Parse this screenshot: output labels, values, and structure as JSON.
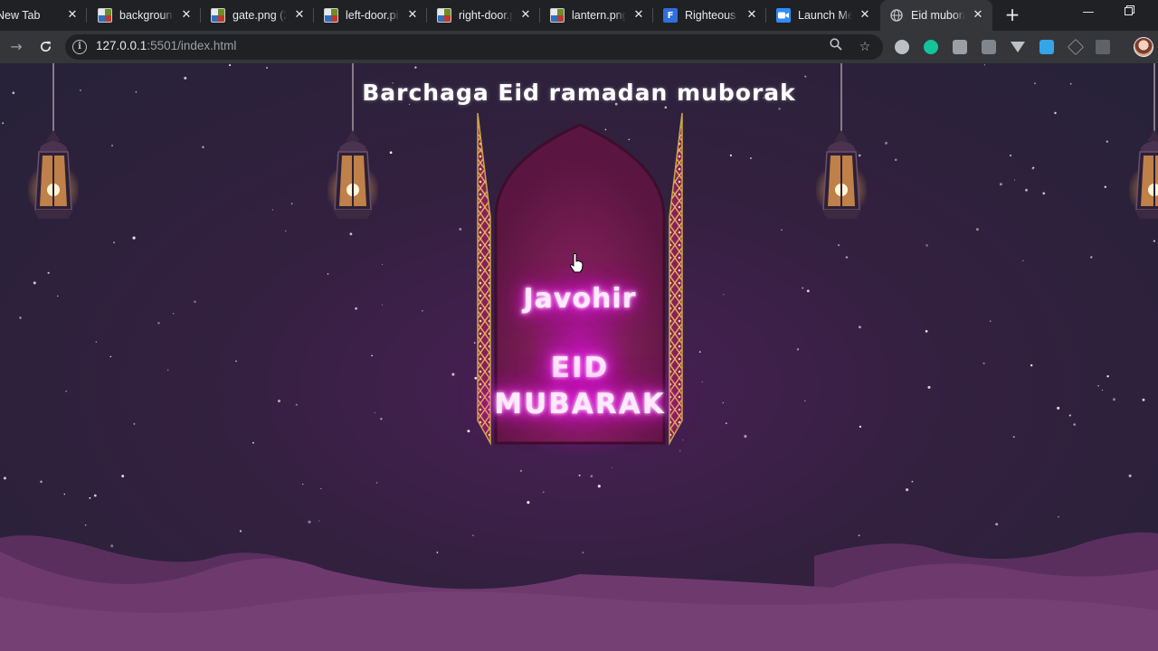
{
  "browser": {
    "tabs": [
      {
        "title": "New Tab",
        "favicon": "none"
      },
      {
        "title": "background",
        "favicon": "image-file-icon"
      },
      {
        "title": "gate.png (2",
        "favicon": "image-file-icon"
      },
      {
        "title": "left-door.pi",
        "favicon": "image-file-icon"
      },
      {
        "title": "right-door.p",
        "favicon": "image-file-icon"
      },
      {
        "title": "lantern.png",
        "favicon": "image-file-icon"
      },
      {
        "title": "Righteous -",
        "favicon": "font-f-icon"
      },
      {
        "title": "Launch Me",
        "favicon": "zoom-camera-icon"
      },
      {
        "title": "Eid muborak",
        "favicon": "globe-icon",
        "active": true
      }
    ],
    "new_tab_symbol": "+",
    "close_symbol": "✕",
    "url_host": "127.0.0.1",
    "url_rest": ":5501/index.html"
  },
  "page": {
    "title": "Barchaga Eid ramadan muborak",
    "name": "Javohir",
    "greeting_line1": "EID",
    "greeting_line2": "MUBARAK"
  },
  "colors": {
    "neon_pink": "#ff1fff",
    "sky_dark": "#262238",
    "sky_center": "#4a1f55",
    "dune_near": "#6e3a6e",
    "dune_far": "#5a2f5e",
    "gate_gold": "#c9a64a",
    "gate_inner": "#7a1d56"
  }
}
